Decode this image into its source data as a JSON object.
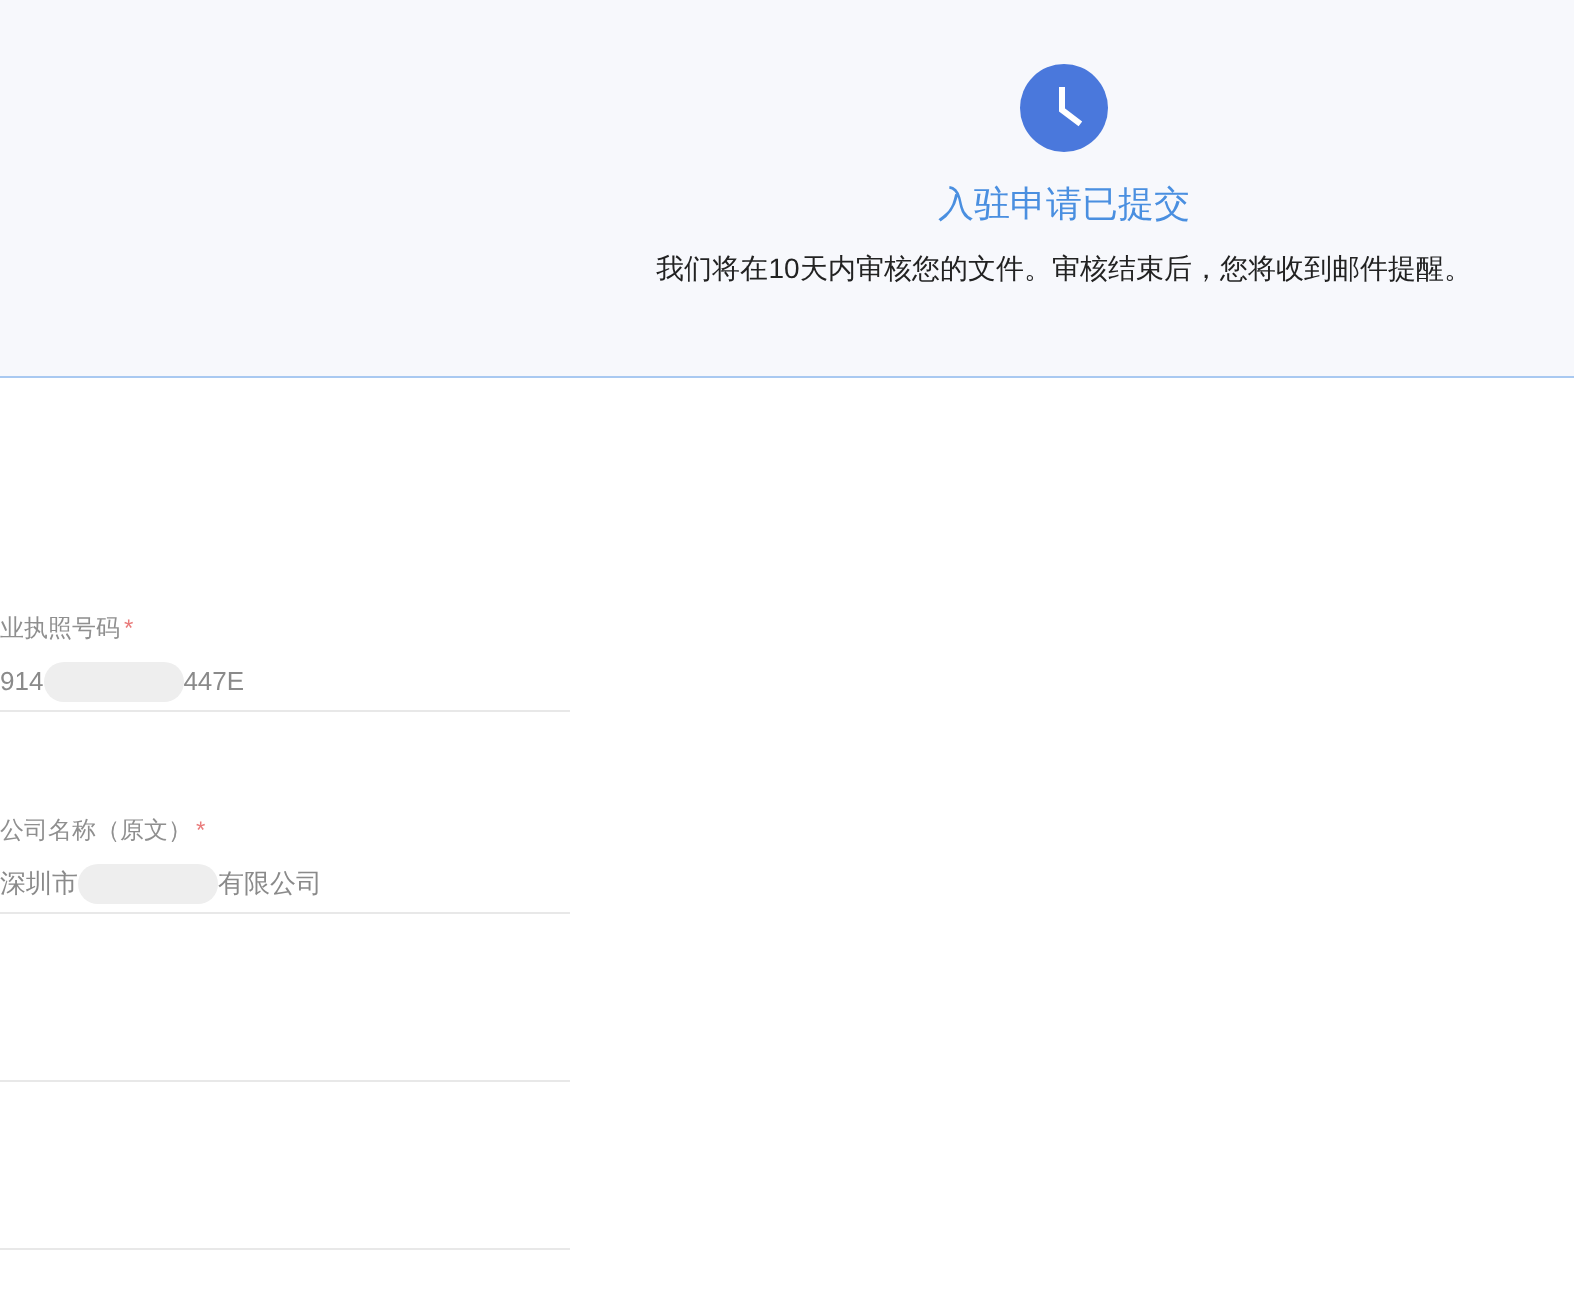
{
  "header": {
    "title": "入驻申请已提交",
    "message": "我们将在10天内审核您的文件。审核结束后，您将收到邮件提醒。"
  },
  "form": {
    "fields": [
      {
        "kind": "filled",
        "label": "业执照号码",
        "required_mark": "*",
        "value": [
          {
            "kind": "text",
            "text": "914"
          },
          {
            "kind": "redacted"
          },
          {
            "kind": "text",
            "text": "447E"
          }
        ]
      },
      {
        "kind": "filled",
        "label": "公司名称（原文）",
        "required_mark": "*",
        "value": [
          {
            "kind": "text",
            "text": "深圳市"
          },
          {
            "kind": "redacted"
          },
          {
            "kind": "text",
            "text": "有限公司"
          }
        ]
      },
      {
        "kind": "blank"
      },
      {
        "kind": "blank"
      }
    ]
  }
}
